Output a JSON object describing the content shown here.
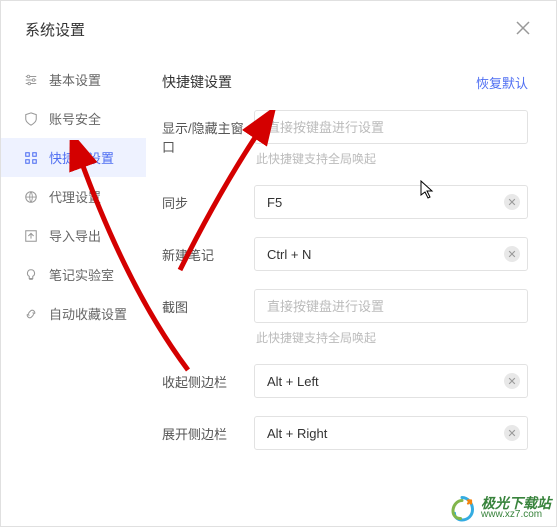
{
  "header": {
    "title": "系统设置"
  },
  "sidebar": {
    "items": [
      {
        "label": "基本设置"
      },
      {
        "label": "账号安全"
      },
      {
        "label": "快捷键设置"
      },
      {
        "label": "代理设置"
      },
      {
        "label": "导入导出"
      },
      {
        "label": "笔记实验室"
      },
      {
        "label": "自动收藏设置"
      }
    ]
  },
  "main": {
    "section_title": "快捷键设置",
    "restore_label": "恢复默认",
    "placeholder": "直接按键盘进行设置",
    "global_hint": "此快捷键支持全局唤起",
    "rows": {
      "toggle_window": {
        "label": "显示/隐藏主窗口",
        "value": ""
      },
      "sync": {
        "label": "同步",
        "value": "F5"
      },
      "new_note": {
        "label": "新建笔记",
        "value": "Ctrl + N"
      },
      "screenshot": {
        "label": "截图",
        "value": ""
      },
      "collapse_sidebar": {
        "label": "收起侧边栏",
        "value": "Alt + Left"
      },
      "expand_sidebar": {
        "label": "展开侧边栏",
        "value": "Alt + Right"
      }
    }
  },
  "watermark": {
    "name": "极光下载站",
    "url": "www.xz7.com"
  }
}
